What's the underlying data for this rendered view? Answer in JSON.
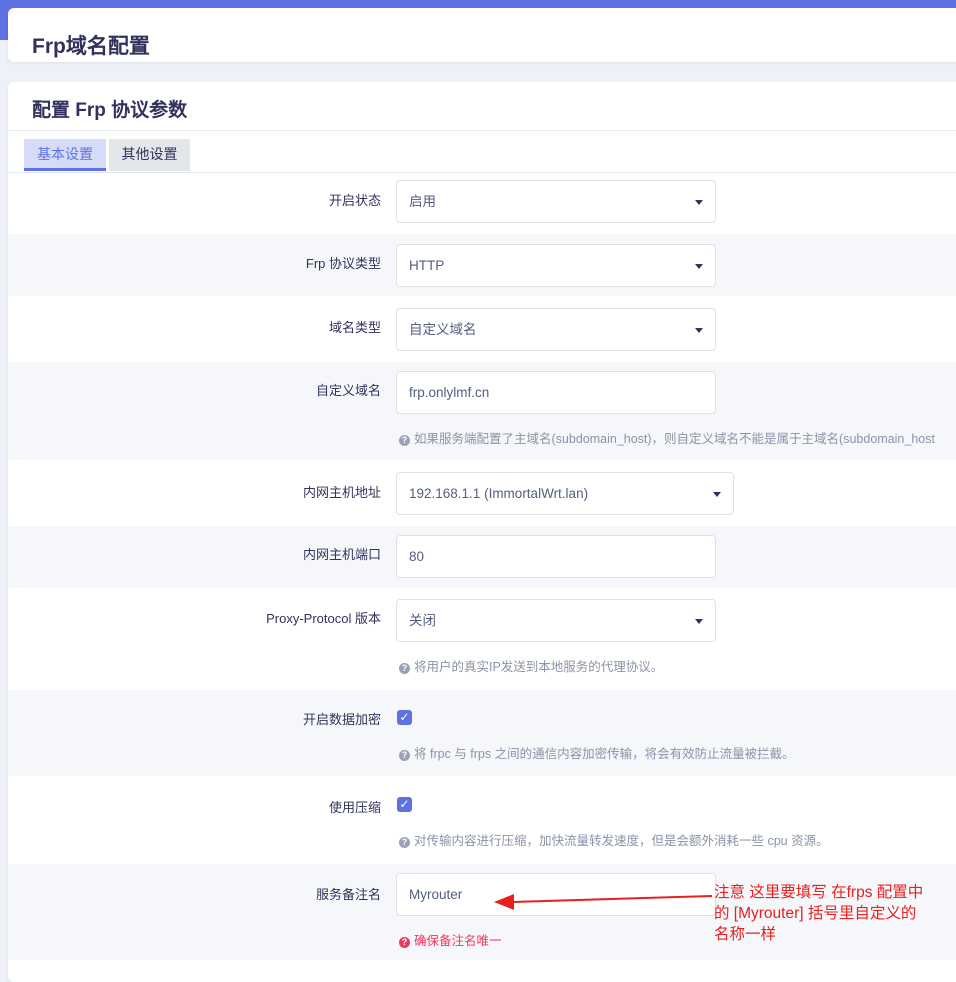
{
  "page": {
    "title": "Frp域名配置"
  },
  "section": {
    "title": "配置 Frp 协议参数"
  },
  "tabs": [
    {
      "label": "基本设置",
      "active": true
    },
    {
      "label": "其他设置",
      "active": false
    }
  ],
  "form": {
    "enable_state": {
      "label": "开启状态",
      "value": "启用"
    },
    "protocol_type": {
      "label": "Frp 协议类型",
      "value": "HTTP"
    },
    "domain_type": {
      "label": "域名类型",
      "value": "自定义域名"
    },
    "custom_domain": {
      "label": "自定义域名",
      "value": "frp.onlylmf.cn",
      "help": "如果服务端配置了主域名(subdomain_host)，则自定义域名不能是属于主域名(subdomain_host"
    },
    "local_host": {
      "label": "内网主机地址",
      "value": "192.168.1.1 (ImmortalWrt.lan)"
    },
    "local_port": {
      "label": "内网主机端口",
      "value": "80"
    },
    "proxy_protocol": {
      "label": "Proxy-Protocol 版本",
      "value": "关闭",
      "help": "将用户的真实IP发送到本地服务的代理协议。"
    },
    "encryption": {
      "label": "开启数据加密",
      "checked": true,
      "help": "将 frpc 与 frps 之间的通信内容加密传输，将会有效防止流量被拦截。"
    },
    "compression": {
      "label": "使用压缩",
      "checked": true,
      "help": "对传输内容进行压缩，加快流量转发速度，但是会额外消耗一些 cpu 资源。"
    },
    "service_name": {
      "label": "服务备注名",
      "value": "Myrouter",
      "help": "确保备注名唯一"
    }
  },
  "annotation": {
    "lines": [
      "注意  这里要填写 在frps 配置中",
      "的 [Myrouter]  括号里自定义的",
      "名称一样"
    ],
    "color": "#e8201f"
  },
  "colors": {
    "accent": "#5e72e4",
    "warning": "#f5365c"
  },
  "icons": {
    "help": "question-circle-icon",
    "caret": "chevron-down-icon",
    "check": "check-icon",
    "arrow": "arrow-left-icon"
  }
}
